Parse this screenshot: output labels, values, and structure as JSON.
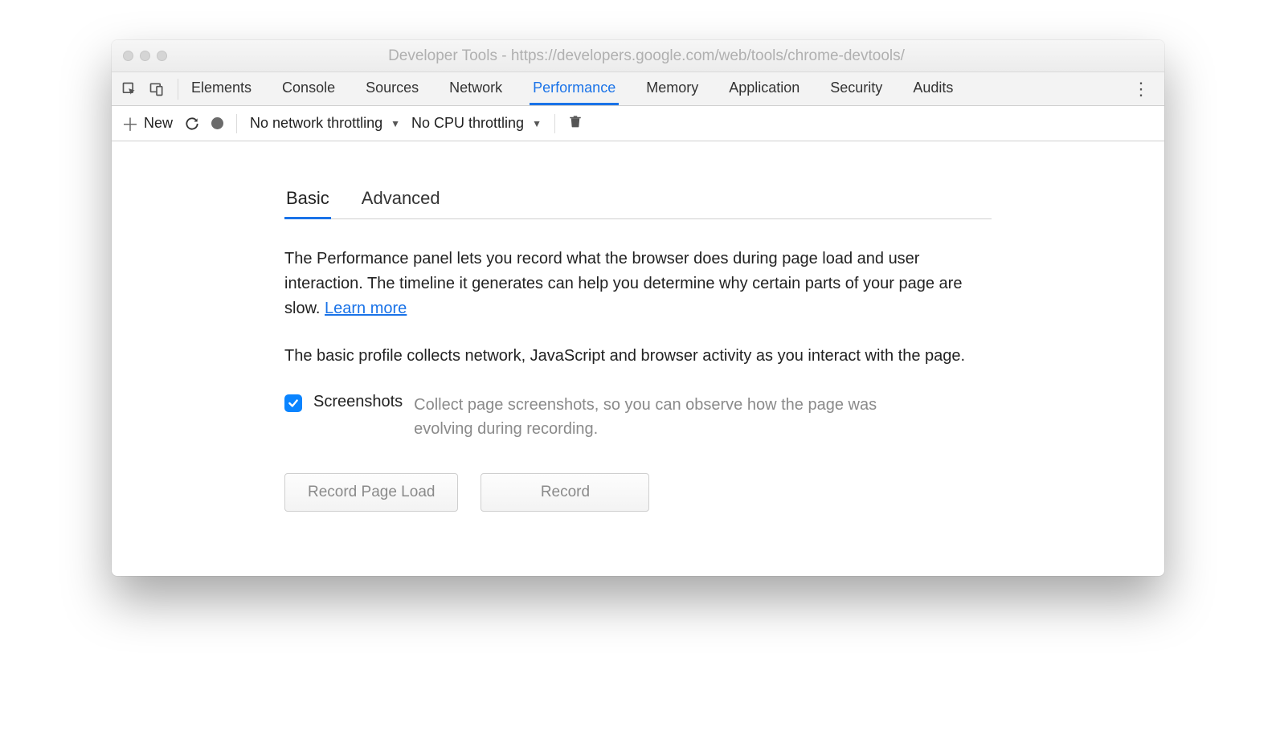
{
  "window": {
    "title": "Developer Tools - https://developers.google.com/web/tools/chrome-devtools/"
  },
  "tabs": {
    "items": [
      "Elements",
      "Console",
      "Sources",
      "Network",
      "Performance",
      "Memory",
      "Application",
      "Security",
      "Audits"
    ],
    "active_index": 4
  },
  "toolbar": {
    "new_label": "New",
    "network_throttle": "No network throttling",
    "cpu_throttle": "No CPU throttling"
  },
  "subtabs": {
    "items": [
      "Basic",
      "Advanced"
    ],
    "active_index": 0
  },
  "body": {
    "intro": "The Performance panel lets you record what the browser does during page load and user interaction. The timeline it generates can help you determine why certain parts of your page are slow.  ",
    "learn_more": "Learn more",
    "basic_desc": "The basic profile collects network, JavaScript and browser activity as you interact with the page.",
    "option_label": "Screenshots",
    "option_desc": "Collect page screenshots, so you can observe how the page was evolving during recording.",
    "option_checked": true,
    "btn_record_page_load": "Record Page Load",
    "btn_record": "Record"
  }
}
